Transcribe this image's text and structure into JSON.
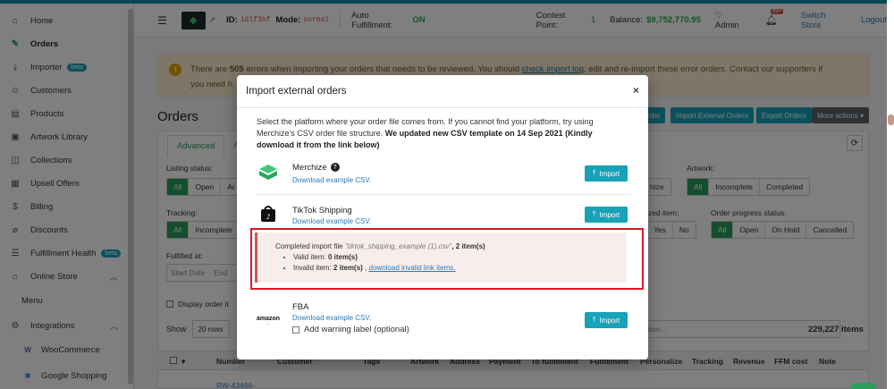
{
  "sidebar": {
    "items": [
      {
        "label": "Home",
        "icon": "home-icon"
      },
      {
        "label": "Orders",
        "icon": "edit-icon"
      },
      {
        "label": "Importer",
        "icon": "download-icon",
        "badge": "beta"
      },
      {
        "label": "Customers",
        "icon": "user-icon"
      },
      {
        "label": "Products",
        "icon": "box-icon"
      },
      {
        "label": "Artwork Library",
        "icon": "image-icon"
      },
      {
        "label": "Collections",
        "icon": "cube-icon"
      },
      {
        "label": "Upsell Offers",
        "icon": "gift-icon"
      },
      {
        "label": "Billing",
        "icon": "dollar-icon"
      },
      {
        "label": "Discounts",
        "icon": "tag-icon"
      },
      {
        "label": "Fulfillment Health",
        "icon": "list-icon",
        "badge": "beta"
      },
      {
        "label": "Online Store",
        "icon": "store-icon"
      },
      {
        "label": "Menu",
        "icon": ""
      },
      {
        "label": "Integrations",
        "icon": "integration-icon"
      },
      {
        "label": "WooCommerce",
        "icon": "woo-icon"
      },
      {
        "label": "Google Shopping",
        "icon": "shopping-bag-icon"
      }
    ]
  },
  "topbar": {
    "id_label": "ID:",
    "id_value": "16lf3hf",
    "mode_label": "Mode:",
    "mode_value": "normal",
    "auto_label": "Auto Fulfillment:",
    "auto_value": "ON",
    "contest_label": "Contest Point:",
    "contest_value": "1",
    "balance_label": "Balance:",
    "balance_value": "$9,752,770.95",
    "admin": "Admin",
    "notif_badge": "99+",
    "switch_store": "Switch Store",
    "logout": "Logout"
  },
  "alert": {
    "line1_pre": "There are",
    "count": "505",
    "line1_post": "errors when importing your orders that needs to be reviewed. You should",
    "link": "check import log",
    "line1_end": ", edit and re-import these error orders. Contact our supporters if",
    "line2": "you need h"
  },
  "page": {
    "title": "Orders",
    "tab_advanced": "Advanced",
    "tab_other": "Atte",
    "btn_order": "rder",
    "btn_import_external": "Import External Orders",
    "btn_export": "Export Orders",
    "btn_more": "More actions ▾",
    "listing_status_label": "Listing status:",
    "listing_opts": [
      "All",
      "Open",
      "Ar"
    ],
    "artwork_label": "Artwork:",
    "artwork_opts": [
      "All",
      "Incomplete",
      "Completed"
    ],
    "artwork_partial": "hize",
    "tracking_label": "Tracking:",
    "tracking_opts": [
      "All",
      "Incomplete"
    ],
    "ized_item_label": "ized item:",
    "ized_opts": [
      "Yes",
      "No"
    ],
    "progress_label": "Order progress status:",
    "progress_opts": [
      "All",
      "Open",
      "On Hold",
      "Cancelled"
    ],
    "fulfilled_label": "Fulfilled at:",
    "start_date": "Start Date",
    "end_date": "End",
    "display_order": "Display order it",
    "show_label": "Show",
    "rows_value": "20 rows",
    "search_placeholder": "umber...",
    "items_count": "229,227 items",
    "columns": [
      "Number",
      "Customer",
      "Tags",
      "Artwork",
      "Address",
      "Payment",
      "To fulfillment",
      "Fulfillment",
      "Personalize",
      "Tracking",
      "Revenue",
      "FFM cost",
      "Note"
    ],
    "first_row_number": "RW-43466-"
  },
  "modal": {
    "title": "Import external orders",
    "intro_plain": "Select the platform where your order file comes from. If you cannot find your platform, try using Merchize's CSV order file structure.",
    "intro_bold": "We updated new CSV template on 14 Sep 2021 (Kindly download it from the link below)",
    "import_label": "Import",
    "platforms": [
      {
        "name": "Merchize",
        "link": "Download example CSV."
      },
      {
        "name": "TikTok Shipping",
        "link": "Download example CSV."
      },
      {
        "name": "FBA",
        "link": "Download example CSV."
      }
    ],
    "result": {
      "completed_pre": "Completed import file",
      "filename": "\"tiktok_shipping_example (1).csv\"",
      "completed_post": ", 2 item(s)",
      "valid_label": "Valid item:",
      "valid_value": "0 item(s)",
      "invalid_label": "Invalid item:",
      "invalid_value": "2 item(s)",
      "invalid_sep": ",",
      "invalid_link": "download invalid link items."
    },
    "warning_label": "Add warning label (optional)",
    "amazon_text": "amazon"
  }
}
